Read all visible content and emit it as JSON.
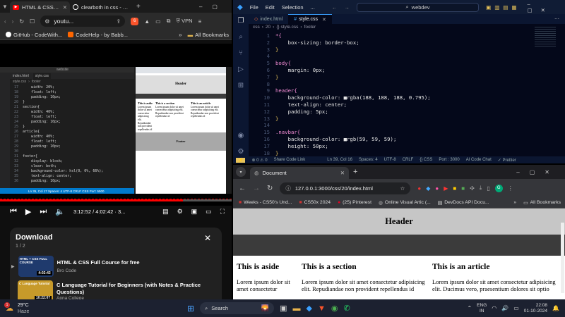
{
  "left_browser": {
    "tabs": [
      {
        "title": "HTML & CSS Full C",
        "icon": "youtube-icon"
      },
      {
        "title": "clearboth in css - Brav",
        "icon": "brave-icon"
      }
    ],
    "address": "youtu...",
    "vpn_label": "VPN",
    "shield_count": "6",
    "bookmarks": [
      {
        "label": "GitHub - CodeWith...",
        "icon": "github-icon"
      },
      {
        "label": "CodeHelp - by Babb...",
        "icon": "codehelp-icon"
      }
    ],
    "all_bookmarks": "All Bookmarks"
  },
  "video": {
    "time": "3:12:52 / 4:02:42",
    "chapter": "3...",
    "progress": 0.79,
    "inner_editor": {
      "window_title": "website",
      "tabs": [
        "index.html",
        "style.css"
      ],
      "breadcrumb": [
        "style.css",
        "footer"
      ],
      "lines": [
        {
          "n": "17",
          "text": "    width: 20%;"
        },
        {
          "n": "18",
          "text": "    float: left;"
        },
        {
          "n": "19",
          "text": "    padding: 10px;"
        },
        {
          "n": "20",
          "text": "}"
        },
        {
          "n": "21",
          "text": "section{"
        },
        {
          "n": "22",
          "text": "    width: 40%;"
        },
        {
          "n": "23",
          "text": "    float: left;"
        },
        {
          "n": "24",
          "text": "    padding: 10px;"
        },
        {
          "n": "25",
          "text": "}"
        },
        {
          "n": "26",
          "text": "article{"
        },
        {
          "n": "27",
          "text": "    width: 40%;"
        },
        {
          "n": "28",
          "text": "    float: left;"
        },
        {
          "n": "29",
          "text": "    padding: 10px;"
        },
        {
          "n": "30",
          "text": ""
        },
        {
          "n": "31",
          "text": "footer{"
        },
        {
          "n": "32",
          "text": "    display: block;"
        },
        {
          "n": "33",
          "text": "    clear: both;"
        },
        {
          "n": "34",
          "text": "    background-color: hsl(0, 0%, 66%);"
        },
        {
          "n": "35",
          "text": "    text-align: center;"
        },
        {
          "n": "36",
          "text": "    padding: 10px;"
        }
      ],
      "status": "Ln 35, Col 17   Spaces: 4   UTF-8   CRLF   CSS   Port: 5500",
      "preview": {
        "header": "Header",
        "aside": "This is aside",
        "section": "This is a section",
        "article": "This is an article",
        "footer": "Footer",
        "lorem": "Lorem ipsum dolor sit amet consectetur adipisicing elit. Repudiandae non provident repellendus id"
      }
    }
  },
  "download": {
    "title": "Download",
    "count": "1 / 2",
    "items": [
      {
        "title": "HTML & CSS Full Course for free",
        "channel": "Bro Code",
        "duration": "4:02:43",
        "thumb_text": "HTML + CSS FULL COURSE"
      },
      {
        "title": "C Language Tutorial for Beginners (with Notes & Practice Questions)",
        "channel": "Apna College",
        "duration": "10:22:07",
        "thumb_text": "C Language Tutorial"
      }
    ]
  },
  "vscode": {
    "menu": [
      "File",
      "Edit",
      "Selection",
      "..."
    ],
    "search": "webdev",
    "tabs": [
      {
        "label": "index.html",
        "active": false
      },
      {
        "label": "style.css",
        "active": true
      }
    ],
    "breadcrumb": [
      "css",
      "20",
      "{} style.css",
      "footer"
    ],
    "lines": [
      {
        "n": "1",
        "text": "*{",
        "cls": "sel"
      },
      {
        "n": "2",
        "text": "    box-sizing: border-box;",
        "cls": "prop"
      },
      {
        "n": "3",
        "text": "}",
        "cls": "brace"
      },
      {
        "n": "4",
        "text": "",
        "cls": ""
      },
      {
        "n": "5",
        "text": "body{",
        "cls": "sel"
      },
      {
        "n": "6",
        "text": "    margin: 0px;",
        "cls": "prop"
      },
      {
        "n": "7",
        "text": "}",
        "cls": "brace"
      },
      {
        "n": "8",
        "text": "",
        "cls": ""
      },
      {
        "n": "9",
        "text": "header{",
        "cls": "sel"
      },
      {
        "n": "10",
        "text": "    background-color: ■rgba(188, 188, 188, 0.795);",
        "cls": "prop"
      },
      {
        "n": "11",
        "text": "    text-align: center;",
        "cls": "prop"
      },
      {
        "n": "12",
        "text": "    padding: 5px;",
        "cls": "prop"
      },
      {
        "n": "13",
        "text": "}",
        "cls": "brace"
      },
      {
        "n": "14",
        "text": "",
        "cls": ""
      },
      {
        "n": "15",
        "text": ".navbar{",
        "cls": "sel"
      },
      {
        "n": "16",
        "text": "    background-color: ■rgb(59, 59, 59);",
        "cls": "prop"
      },
      {
        "n": "17",
        "text": "    height: 50px;",
        "cls": "prop"
      },
      {
        "n": "18",
        "text": "}",
        "cls": "brace"
      }
    ],
    "status": [
      "⊗ 0  ⚠ 0",
      "Share Code Link",
      "Ln 39, Col 16",
      "Spaces: 4",
      "UTF-8",
      "CRLF",
      "{} CSS",
      "Port : 3000",
      "AI Code Chat",
      "✓ Prettier"
    ]
  },
  "chrome": {
    "tab_title": "Document",
    "url": "127.0.0.1:3000/css/20/index.html",
    "bookmarks": [
      {
        "label": "Weeks - CS50's Und...",
        "icon": "cs50-icon"
      },
      {
        "label": "CS50x 2024",
        "icon": "cs50-icon"
      },
      {
        "label": "(25) Pinterest",
        "icon": "pinterest-icon"
      },
      {
        "label": "Online Visual Artic (...",
        "icon": "globe-icon"
      },
      {
        "label": "DevDocs API Docu...",
        "icon": "devdocs-icon"
      }
    ],
    "all_bookmarks": "All Bookmarks",
    "page": {
      "header": "Header",
      "aside_title": "This is aside",
      "section_title": "This is a section",
      "article_title": "This is an article",
      "aside_text": "Lorem ipsum dolor sit amet consectetur",
      "section_text": "Lorem ipsum dolor sit amet consectetur adipisicing elit. Repudiandae non provident repellendus id",
      "article_text": "Lorem ipsum dolor sit amet consectetur adipisicing elit. Ducimus vero, praesentium dolores sit optio"
    }
  },
  "taskbar": {
    "weather_temp": "29°C",
    "weather_desc": "Haze",
    "search_placeholder": "Search",
    "lang_top": "ENG",
    "lang_bottom": "IN",
    "time": "22:08",
    "date": "01-10-2024",
    "badge": "1"
  }
}
